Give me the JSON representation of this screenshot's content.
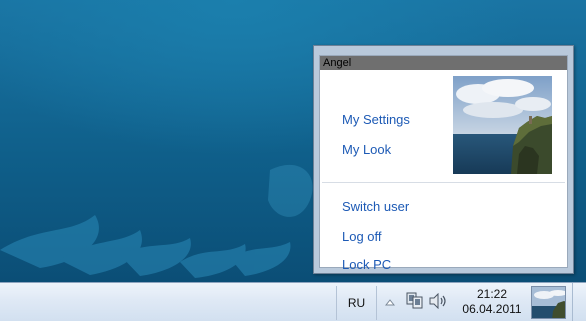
{
  "popup": {
    "user_name": "Angel",
    "links": {
      "my_settings": "My Settings",
      "my_look": "My Look",
      "switch_user": "Switch user",
      "log_off": "Log off",
      "lock_pc": "Lock PC"
    },
    "photo_icon": "user-photo-coastal-cliff"
  },
  "taskbar": {
    "language": "RU",
    "tray_icons": [
      "show-hidden-icons-arrow",
      "network-icon",
      "volume-icon"
    ],
    "time": "21:22",
    "date": "06.04.2011",
    "thumbnail_icon": "user-thumbnail"
  },
  "colors": {
    "link": "#1d5ab5",
    "title_bar": "#6f6f6f",
    "desktop": "#0d5f88"
  }
}
